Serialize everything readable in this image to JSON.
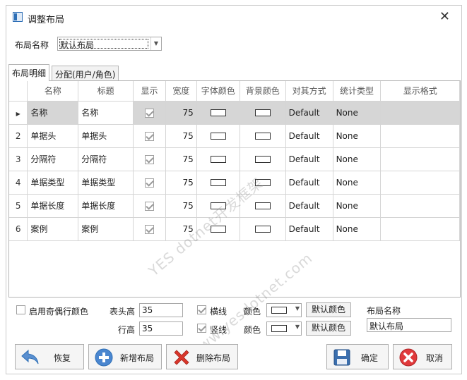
{
  "window": {
    "title": "调整布局"
  },
  "layout_name": {
    "label": "布局名称",
    "value": "默认布局"
  },
  "tabs": [
    {
      "label": "布局明细"
    },
    {
      "label": "分配(用户/角色)"
    }
  ],
  "grid": {
    "columns": [
      "名称",
      "标题",
      "显示",
      "宽度",
      "字体颜色",
      "背景颜色",
      "对其方式",
      "统计类型",
      "显示格式"
    ],
    "rows": [
      {
        "rn": "",
        "name": "名称",
        "caption": "名称",
        "visible": true,
        "width": "75",
        "align": "Default",
        "stat": "None",
        "format": ""
      },
      {
        "rn": "2",
        "name": "单据头",
        "caption": "单据头",
        "visible": true,
        "width": "75",
        "align": "Default",
        "stat": "None",
        "format": ""
      },
      {
        "rn": "3",
        "name": "分隔符",
        "caption": "分隔符",
        "visible": true,
        "width": "75",
        "align": "Default",
        "stat": "None",
        "format": ""
      },
      {
        "rn": "4",
        "name": "单据类型",
        "caption": "单据类型",
        "visible": true,
        "width": "75",
        "align": "Default",
        "stat": "None",
        "format": ""
      },
      {
        "rn": "5",
        "name": "单据长度",
        "caption": "单据长度",
        "visible": true,
        "width": "75",
        "align": "Default",
        "stat": "None",
        "format": ""
      },
      {
        "rn": "6",
        "name": "案例",
        "caption": "案例",
        "visible": true,
        "width": "75",
        "align": "Default",
        "stat": "None",
        "format": ""
      }
    ]
  },
  "watermark": {
    "line1": "YES dotnet开发框架",
    "line2": "www.yesdotnet.com"
  },
  "options": {
    "alt_color_label": "启用奇偶行颜色",
    "header_height_label": "表头高",
    "header_height": "35",
    "row_height_label": "行高",
    "row_height": "35",
    "hline_label": "横线",
    "vline_label": "竖线",
    "color_label": "颜色",
    "default_color_button": "默认颜色",
    "layout_name_label": "布局名称",
    "layout_name_value": "默认布局"
  },
  "buttons": {
    "restore": "恢复",
    "add_layout": "新增布局",
    "delete_layout": "删除布局",
    "ok": "确定",
    "cancel": "取消"
  },
  "colors": {
    "accent_blue": "#2e6fb6",
    "delete_red": "#d9362b",
    "cancel_red": "#e0393b"
  }
}
